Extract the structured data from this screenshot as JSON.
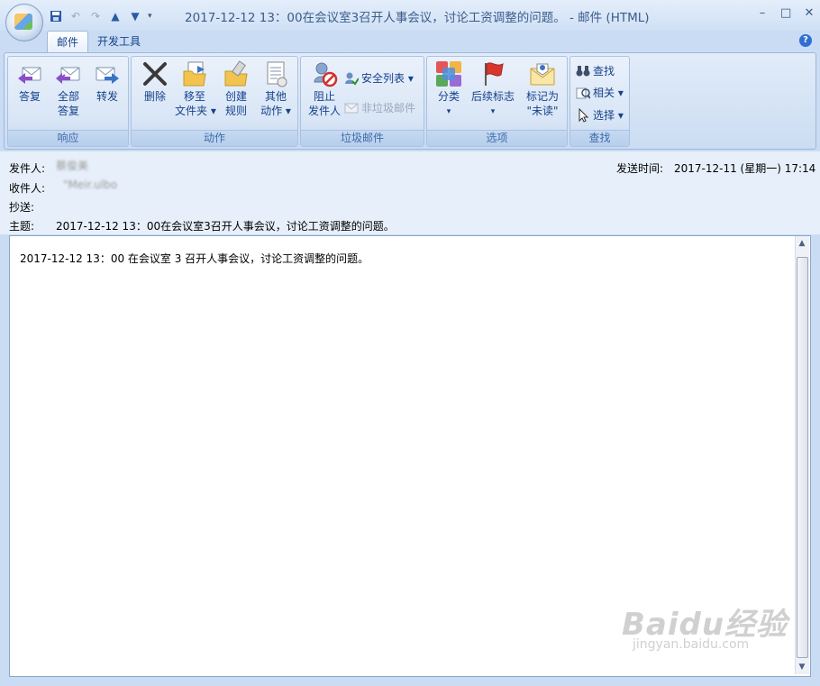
{
  "window": {
    "title": "2017-12-12 13：00在会议室3召开人事会议，讨论工资调整的问题。 - 邮件 (HTML)",
    "controls": [
      "–",
      "□",
      "✕"
    ]
  },
  "tabs": [
    {
      "label": "邮件",
      "active": true
    },
    {
      "label": "开发工具",
      "active": false
    }
  ],
  "ribbon": {
    "respond": {
      "title": "响应",
      "reply": "答复",
      "reply_all_1": "全部",
      "reply_all_2": "答复",
      "forward": "转发"
    },
    "actions": {
      "title": "动作",
      "delete": "删除",
      "move_1": "移至",
      "move_2": "文件夹 ▾",
      "rules_1": "创建",
      "rules_2": "规则",
      "other_1": "其他",
      "other_2": "动作 ▾"
    },
    "junk": {
      "title": "垃圾邮件",
      "block_1": "阻止",
      "block_2": "发件人",
      "safe_lists": "安全列表 ▾",
      "not_junk": "非垃圾邮件"
    },
    "options": {
      "title": "选项",
      "categorize": "分类",
      "categorize_arrow": "▾",
      "followup": "后续标志",
      "followup_arrow": "▾",
      "mark_1": "标记为",
      "mark_2": "\"未读\""
    },
    "find": {
      "title": "查找",
      "find": "查找",
      "related": "相关 ▾",
      "select": "选择 ▾"
    }
  },
  "header": {
    "from_label": "发件人:",
    "from_value": "蔡俊美",
    "to_label": "收件人:",
    "to_value": "\"Meir.ulbo",
    "cc_label": "抄送:",
    "subject_label": "主题:",
    "subject_value": "2017-12-12 13：00在会议室3召开人事会议，讨论工资调整的问题。",
    "sent_label": "发送时间:",
    "sent_value": "2017-12-11 (星期一) 17:14"
  },
  "body": {
    "text": "2017-12-12 13：00 在会议室 3 召开人事会议，讨论工资调整的问题。"
  },
  "watermark": {
    "main": "Baidu经验",
    "sub": "jingyan.baidu.com"
  },
  "colors": {
    "accent": "#15428b",
    "ribbon_bg": "#d9e6f6",
    "frame": "#c9dcf3"
  }
}
